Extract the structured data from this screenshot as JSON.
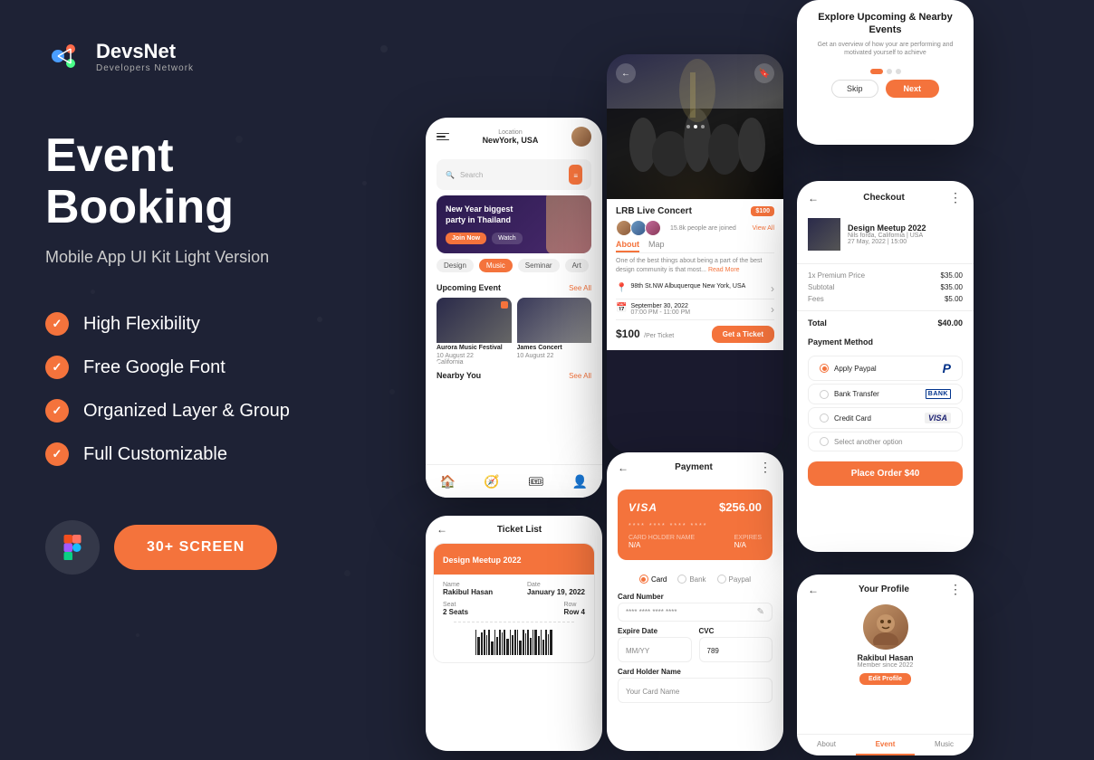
{
  "brand": {
    "name": "DevsNet",
    "tagline": "Developers Network"
  },
  "hero": {
    "title": "Event Booking",
    "subtitle": "Mobile App UI Kit Light Version"
  },
  "features": [
    {
      "label": "High Flexibility"
    },
    {
      "label": "Free Google Font"
    },
    {
      "label": "Organized Layer & Group"
    },
    {
      "label": "Full Customizable"
    }
  ],
  "cta": {
    "screens_label": "30+ SCREEN"
  },
  "phone1": {
    "location_label": "Location",
    "location": "NewYork, USA",
    "search_placeholder": "Search",
    "event_title": "New Year biggest party in Thailand",
    "join_label": "Join Now",
    "watch_label": "Watch",
    "categories": [
      "Design",
      "Music",
      "Seminar",
      "Art"
    ],
    "active_cat": "Music",
    "upcoming_label": "Upcoming Event",
    "see_all": "See All",
    "nearby_label": "Nearby You",
    "event1_name": "Aurora Music Festival",
    "event1_date": "10 August 22",
    "event1_location": "California",
    "event2_name": "James Concert",
    "event2_date": "10 August 22"
  },
  "phone2": {
    "event_name": "LRB Live Concert",
    "price_badge": "$100",
    "people_count": "15.8k people are joined",
    "view_all": "View All",
    "about_label": "About",
    "map_label": "Map",
    "description": "One of the best things about being a part of the best design community is that most...",
    "read_more": "Read More",
    "address": "98th St.NW Albuquerque New York, USA",
    "date": "September 30, 2022",
    "time": "07:00 PM - 11:00 PM",
    "ticket_price": "$100",
    "per_ticket": "/Per Ticket",
    "get_ticket_label": "Get a Ticket"
  },
  "phone3": {
    "title": "Ticket List",
    "event_name": "Design Meetup 2022",
    "name_label": "Name",
    "name_value": "Rakibul Hasan",
    "date_label": "Date",
    "date_value": "January 19, 2022",
    "seat_label": "Seat",
    "seat_value": "2 Seats",
    "row_label": "Row",
    "row_value": "Row 4"
  },
  "phone4": {
    "title": "Payment",
    "card_amount": "$256.00",
    "card_type": "VISA",
    "card_number": "**** **** **** ****",
    "cardholder_label": "CARD HOLDER NAME",
    "exp_label": "EXPIRES",
    "card_holder": "N/A",
    "expires": "N/A",
    "payment_options": [
      "Card",
      "Bank",
      "Paypal"
    ],
    "card_number_label": "Card Number",
    "card_number_input": "**** **** **** ****",
    "expire_date_label": "Expire Date",
    "expire_date_input": "MM/YY",
    "cvc_label": "CVC",
    "cvc_input": "789",
    "holder_label": "Card Holder Name",
    "holder_input": "Your Card Name"
  },
  "phone5": {
    "title": "Explore Upcoming & Nearby Events",
    "description": "Get an overview of how your are performing and motivated yourself to achieve",
    "skip_label": "Skip",
    "next_label": "Next"
  },
  "phone6": {
    "title": "Checkout",
    "event_name": "Design Meetup 2022",
    "event_location": "Nils forda, California | USA",
    "event_date": "27 May, 2022 | 15:00",
    "premium_price_label": "1x Premium Price",
    "premium_price": "$35.00",
    "subtotal_label": "Subtotal",
    "subtotal": "$35.00",
    "fees_label": "Fees",
    "fees": "$5.00",
    "total_label": "Total",
    "total": "$40.00",
    "payment_method_label": "Payment Method",
    "payment_methods": [
      "Apply Paypal",
      "Bank Transfer",
      "Credit Card",
      "Select another option"
    ],
    "place_order_label": "Place Order $40"
  },
  "phone7": {
    "title": "Your Profile",
    "name": "Rakibul Hasan",
    "member_since": "Member since 2022",
    "edit_label": "Edit Profile",
    "tabs": [
      "About",
      "Event",
      "Music"
    ]
  },
  "colors": {
    "orange": "#f4733c",
    "dark_bg": "#1e2235",
    "white": "#ffffff",
    "gray": "#888888"
  }
}
